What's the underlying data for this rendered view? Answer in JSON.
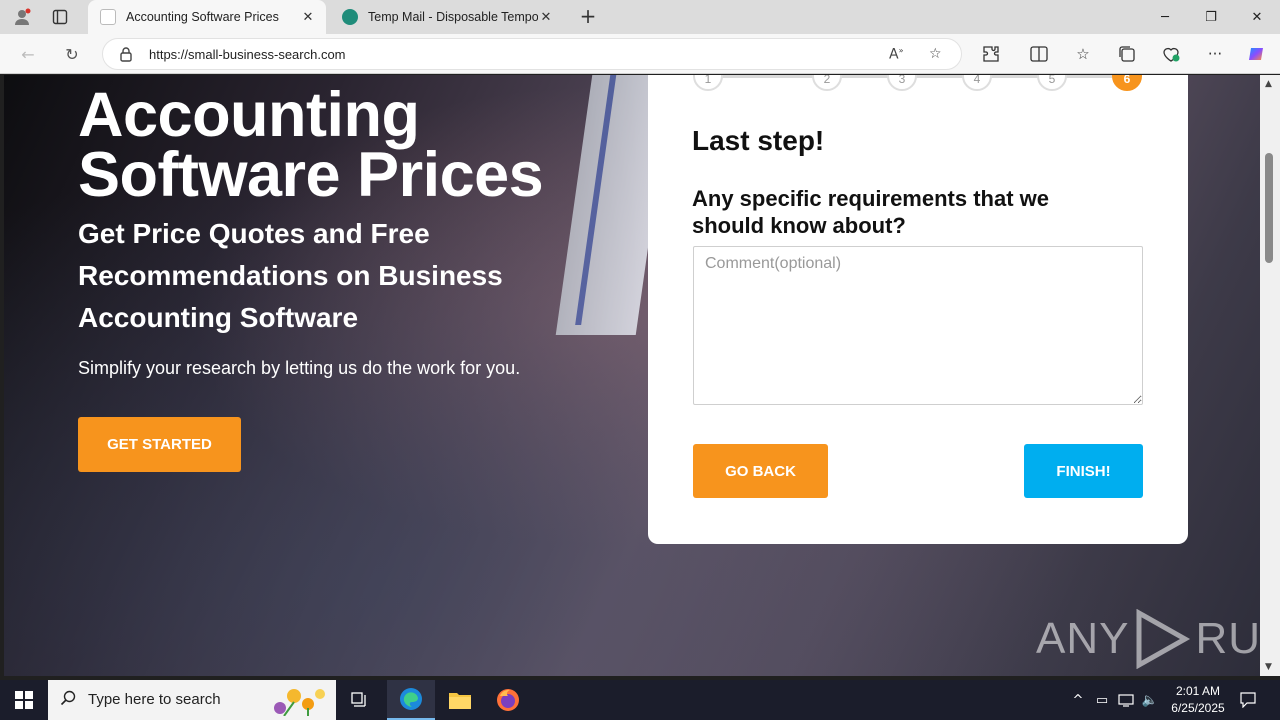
{
  "browser": {
    "tabs": [
      {
        "title": "Accounting Software Prices",
        "active": true
      },
      {
        "title": "Temp Mail - Disposable Temporary",
        "active": false
      }
    ],
    "url": "https://small-business-search.com"
  },
  "hero": {
    "title": "Accounting Software Prices",
    "subtitle": "Get Price Quotes and Free Recommendations on Business Accounting Software",
    "text": "Simplify your research by letting us do the work for you.",
    "cta_label": "GET STARTED"
  },
  "form": {
    "steps": [
      "1",
      "2",
      "3",
      "4",
      "5",
      "6"
    ],
    "current_step": "6",
    "heading": "Last step!",
    "question": "Any specific requirements that we should know about?",
    "comment_placeholder": "Comment(optional)",
    "back_label": "GO BACK",
    "finish_label": "FINISH!"
  },
  "watermark": {
    "text_left": "ANY",
    "text_right": "RUN"
  },
  "taskbar": {
    "search_placeholder": "Type here to search",
    "time": "2:01 AM",
    "date": "6/25/2025"
  },
  "colors": {
    "accent_orange": "#f7941d",
    "accent_blue": "#00aeef"
  }
}
